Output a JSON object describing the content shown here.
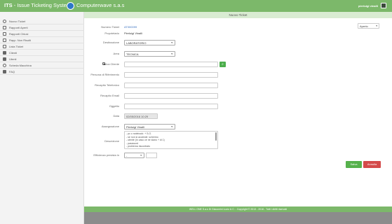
{
  "header": {
    "brand": "ITS",
    "brand_subtitle": "- Issue Ticketing System",
    "company": "Computerwave s.a.s",
    "user": "pierluigi vinalli"
  },
  "sidebar": {
    "items": [
      {
        "label": "Nuovo Ticket"
      },
      {
        "label": "Rapporti Aperti"
      },
      {
        "label": "Rapporti Chiusi"
      },
      {
        "label": "Rapp. Non Risolti"
      },
      {
        "label": "Lista Ticket"
      },
      {
        "label": "Clienti"
      },
      {
        "label": "Utenti"
      },
      {
        "label": "Scheda Macchina"
      },
      {
        "label": "FAQ"
      }
    ]
  },
  "page": {
    "title": "Nuovo Ticket",
    "status_value": "Aperto"
  },
  "form": {
    "numero_ticket_label": "Numero Ticket",
    "numero_ticket_value": "AT000099",
    "proprietario_label": "Proprietario",
    "proprietario_value": "Pierluigi Vinalli",
    "destinazione_label": "Destinazione",
    "destinazione_value": "LABORATORIO",
    "area_label": "Area",
    "area_value": "TECNICA",
    "salva_cliente_label": "Salva Cliente",
    "persona_label": "Persona di Riferimento",
    "recapito_tel_label": "Recapito Telefonico",
    "recapito_email_label": "Recapito Email",
    "oggetto_label": "Oggetto",
    "data_label": "Data",
    "data_value": "02/05/2016 10:29",
    "assegnazione_label": "Assegnazione",
    "assegnazione_value": "Pierluigi Vinalli",
    "descrizione_label": "Descrizione",
    "descrizione_lines": [
      "- pc o notebook: + S.O.",
      "- se non si accende: schermo",
      "- utente (in caso ce ne siano + di 1)",
      "- password",
      "- problema riscontrato"
    ],
    "efficienza_label": "Efficienza prevista in",
    "efficienza_value": "-"
  },
  "buttons": {
    "save": "Salva",
    "cancel": "Annulla"
  },
  "footer": {
    "text": "WELL ONE S.a.s Di Giacomini Lucio & C. - Copyright © 2013 - 2016 - Tutti i diritti riservati"
  }
}
